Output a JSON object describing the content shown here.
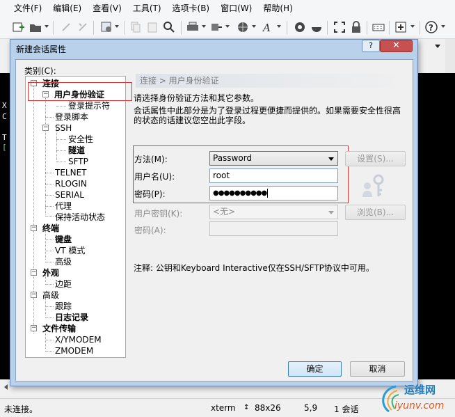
{
  "menubar": {
    "items": [
      "文件(F)",
      "编辑(E)",
      "查看(V)",
      "工具(T)",
      "选项卡(B)",
      "窗口(W)",
      "帮助(H)"
    ]
  },
  "toolbar": {
    "icons": [
      "new-session-icon",
      "open-folder-icon",
      "reconnect-icon",
      "disconnect-icon",
      "properties-icon",
      "copy-icon",
      "paste-icon",
      "find-icon",
      "print-icon",
      "transfer-icon",
      "globe-icon",
      "font-icon",
      "xftp-icon",
      "xshell-icon",
      "fullscreen-icon",
      "lock-icon",
      "keyboard-icon",
      "add-icon",
      "help-icon"
    ]
  },
  "terminal": {
    "lines": [
      "X",
      "C",
      "",
      "T",
      "["
    ]
  },
  "dialog": {
    "title": "新建会话属性",
    "help_label": "?",
    "close_label": "✕",
    "category_label": "类别(C):",
    "tree": [
      {
        "label": "连接",
        "bold": true,
        "toggle": "−"
      },
      {
        "label": "用户身份验证",
        "bold": true,
        "toggle": "−"
      },
      {
        "label": "登录提示符",
        "bold": false
      },
      {
        "label": "登录脚本",
        "bold": false
      },
      {
        "label": "SSH",
        "bold": false,
        "toggle": "−"
      },
      {
        "label": "安全性",
        "bold": false
      },
      {
        "label": "隧道",
        "bold": true
      },
      {
        "label": "SFTP",
        "bold": false
      },
      {
        "label": "TELNET",
        "bold": false
      },
      {
        "label": "RLOGIN",
        "bold": false
      },
      {
        "label": "SERIAL",
        "bold": false
      },
      {
        "label": "代理",
        "bold": false
      },
      {
        "label": "保持活动状态",
        "bold": false
      },
      {
        "label": "终端",
        "bold": true,
        "toggle": "−"
      },
      {
        "label": "键盘",
        "bold": true
      },
      {
        "label": "VT 模式",
        "bold": false
      },
      {
        "label": "高级",
        "bold": false
      },
      {
        "label": "外观",
        "bold": true,
        "toggle": "−"
      },
      {
        "label": "边距",
        "bold": false
      },
      {
        "label": "高级",
        "bold": false,
        "toggle": "−"
      },
      {
        "label": "跟踪",
        "bold": false
      },
      {
        "label": "日志记录",
        "bold": true
      },
      {
        "label": "文件传输",
        "bold": true,
        "toggle": "−"
      },
      {
        "label": "X/YMODEM",
        "bold": false
      },
      {
        "label": "ZMODEM",
        "bold": false
      }
    ],
    "section_header": "连接 > 用户身份验证",
    "desc_line1": "请选择身份验证方法和其它参数。",
    "desc_line2": "会话属性中此部分是为了登录过程更便捷而提供的。如果需要安全性很高",
    "desc_line3": "的状态的话建议您空出此字段。",
    "method_label": "方法(M):",
    "method_value": "Password",
    "settings_button": "设置(S)...",
    "username_label": "用户名(U):",
    "username_value": "root",
    "password_label": "密码(P):",
    "password_value": "●●●●●●●●●●",
    "user_key_label": "用户密钥(K):",
    "user_key_value": "<无>",
    "browse_button": "浏览(B)...",
    "passphrase_label": "密码(A):",
    "passphrase_value": "",
    "note": "注释: 公钥和Keyboard Interactive仅在SSH/SFTP协议中可用。",
    "ok_button": "确定",
    "cancel_button": "取消"
  },
  "statusbar": {
    "status": "未连接。",
    "terminal_type": "xterm",
    "size": "88x26",
    "position": "5,9",
    "sessions": "1 会话"
  },
  "watermark": {
    "text": "运维网",
    "url": "iyunv.com"
  },
  "colors": {
    "dialog_frame": "#b9d1ea",
    "highlight_red": "#e23333",
    "close_red": "#c75050",
    "terminal_bg": "#000000"
  }
}
